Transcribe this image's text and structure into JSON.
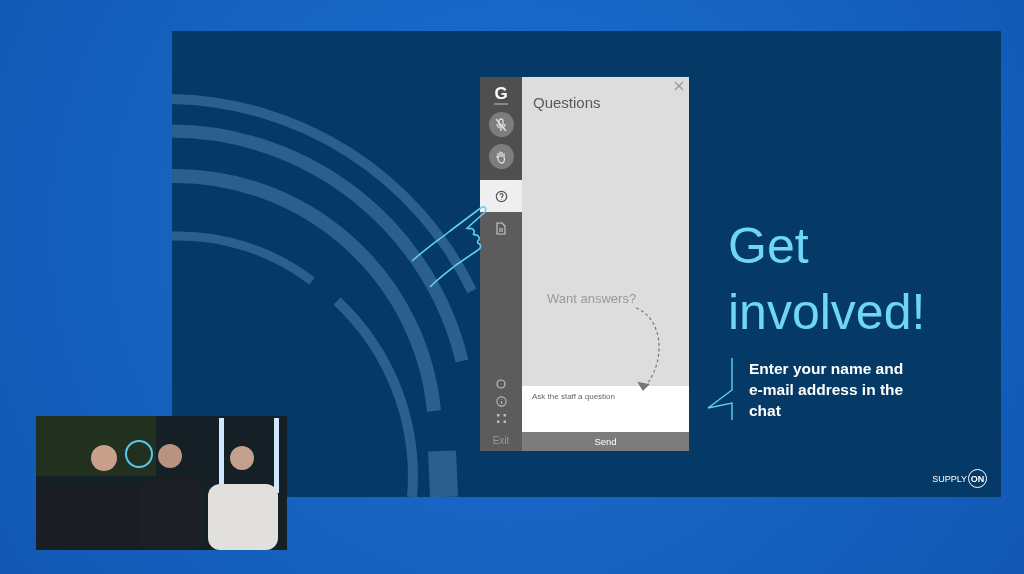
{
  "slide": {
    "headline": "Get involved!",
    "instruction": "Enter your name and e-mail address in the chat",
    "logo_text": "SUPPLY",
    "logo_mark": "ON"
  },
  "panel": {
    "logo": "G",
    "title": "Questions",
    "tools": [
      {
        "kind": "microphone"
      },
      {
        "kind": "hand"
      }
    ],
    "nav": [
      {
        "kind": "questions",
        "selected": true
      },
      {
        "kind": "document",
        "selected": false
      }
    ],
    "bottom_icons": [
      {
        "kind": "circle"
      },
      {
        "kind": "info"
      },
      {
        "kind": "grid"
      }
    ],
    "exit": "Exit",
    "hint": "Want answers?",
    "placeholder": "Ask the staff a question",
    "send": "Send"
  }
}
